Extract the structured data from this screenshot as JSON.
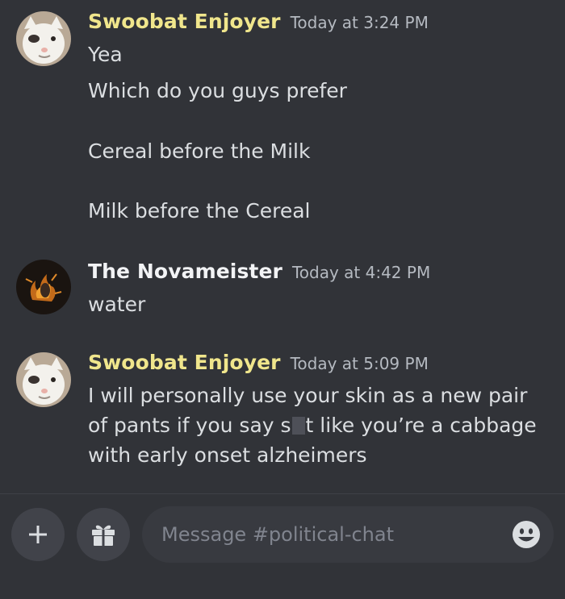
{
  "channel_input": {
    "placeholder": "Message #political-chat",
    "value": ""
  },
  "colors": {
    "background": "#313338",
    "username_highlight": "#f0e68c",
    "username_default": "#f2f3f5",
    "timestamp": "#b5bac1",
    "input_background": "#383a40"
  },
  "messages": [
    {
      "author": "Swoobat Enjoyer",
      "author_color": "#f0e68c",
      "timestamp": "Today at 3:24 PM",
      "avatar": "white-cat-avatar",
      "lines": [
        "Yea",
        "Which do you guys prefer",
        "Cereal before the Milk",
        "Milk before the Cereal"
      ]
    },
    {
      "author": "The Novameister",
      "author_color": "#f2f3f5",
      "timestamp": "Today at 4:42 PM",
      "avatar": "fire-avatar",
      "lines": [
        "water"
      ]
    },
    {
      "author": "Swoobat Enjoyer",
      "author_color": "#f0e68c",
      "timestamp": "Today at 5:09 PM",
      "avatar": "white-cat-avatar",
      "text_before_spoiler": "I will personally use your skin as a new pair of pants if you say s",
      "text_after_spoiler": "t like you’re a cabbage with early onset alzheimers"
    }
  ],
  "composer": {
    "add_icon": "plus-icon",
    "gift_icon": "gift-icon",
    "emoji_icon": "emoji-icon"
  }
}
